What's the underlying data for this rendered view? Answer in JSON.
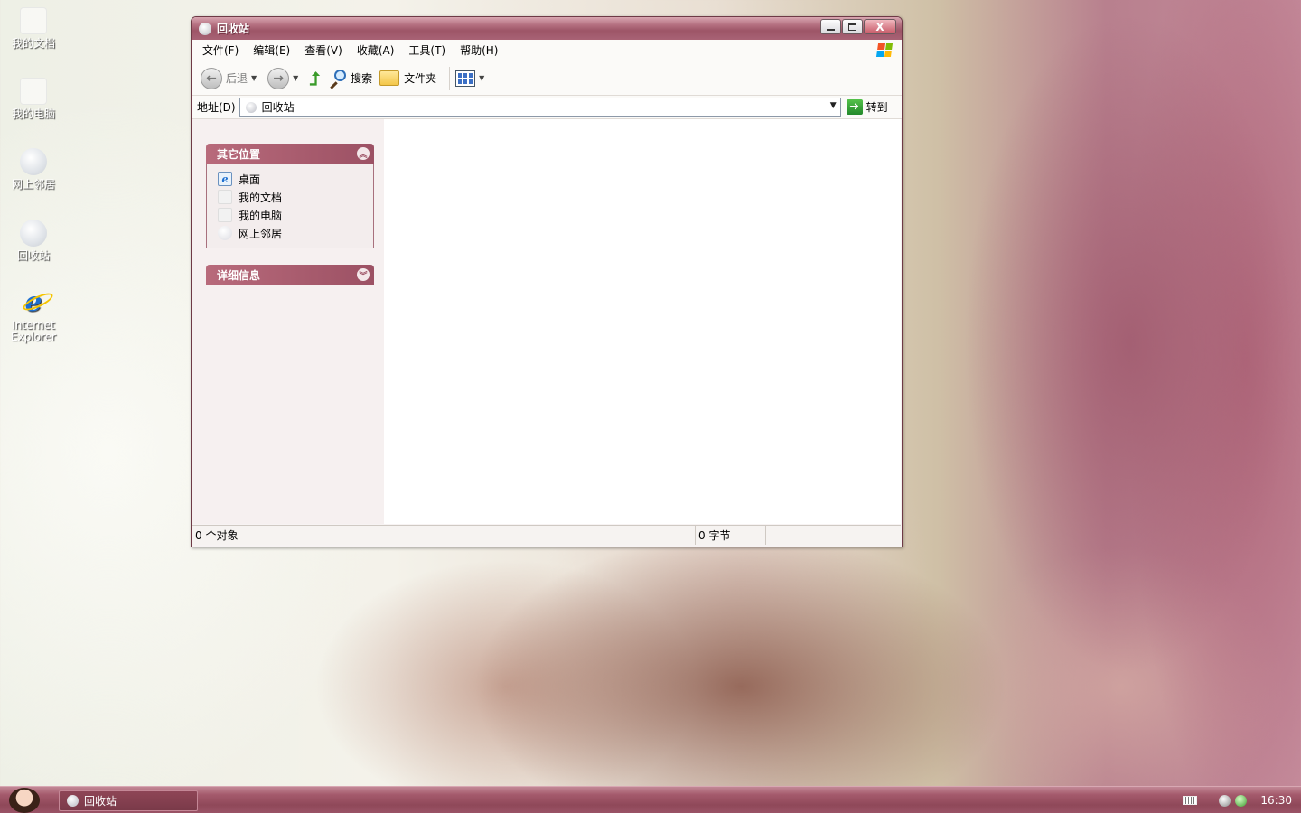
{
  "desktop": {
    "icons": [
      {
        "label": "我的文档",
        "icon": "my-documents-icon"
      },
      {
        "label": "我的电脑",
        "icon": "my-computer-icon"
      },
      {
        "label": "网上邻居",
        "icon": "network-places-icon"
      },
      {
        "label": "回收站",
        "icon": "recycle-bin-icon"
      },
      {
        "label_line1": "Internet",
        "label_line2": "Explorer",
        "icon": "internet-explorer-icon"
      }
    ]
  },
  "window": {
    "title": "回收站",
    "buttons": {
      "minimize": "",
      "maximize": "",
      "close": "X"
    },
    "menu": [
      "文件(F)",
      "编辑(E)",
      "查看(V)",
      "收藏(A)",
      "工具(T)",
      "帮助(H)"
    ],
    "toolbar": {
      "back_label": "后退",
      "search_label": "搜索",
      "folders_label": "文件夹"
    },
    "address": {
      "label": "地址(D)",
      "value": "回收站",
      "go_label": "转到"
    },
    "taskpane": {
      "other_places": {
        "title": "其它位置",
        "toggle": "︽",
        "items": [
          {
            "label": "桌面",
            "icon": "desktop-icon"
          },
          {
            "label": "我的文档",
            "icon": "my-documents-icon"
          },
          {
            "label": "我的电脑",
            "icon": "my-computer-icon"
          },
          {
            "label": "网上邻居",
            "icon": "network-places-icon"
          }
        ]
      },
      "details": {
        "title": "详细信息",
        "toggle": "︾"
      }
    },
    "status": {
      "objects": "0 个对象",
      "bytes": "0 字节"
    }
  },
  "taskbar": {
    "task_title": "回收站",
    "clock": "16:30"
  },
  "colors": {
    "accent": "#9c5164",
    "titlebar": "#a86275",
    "taskbar": "#8f4859"
  }
}
